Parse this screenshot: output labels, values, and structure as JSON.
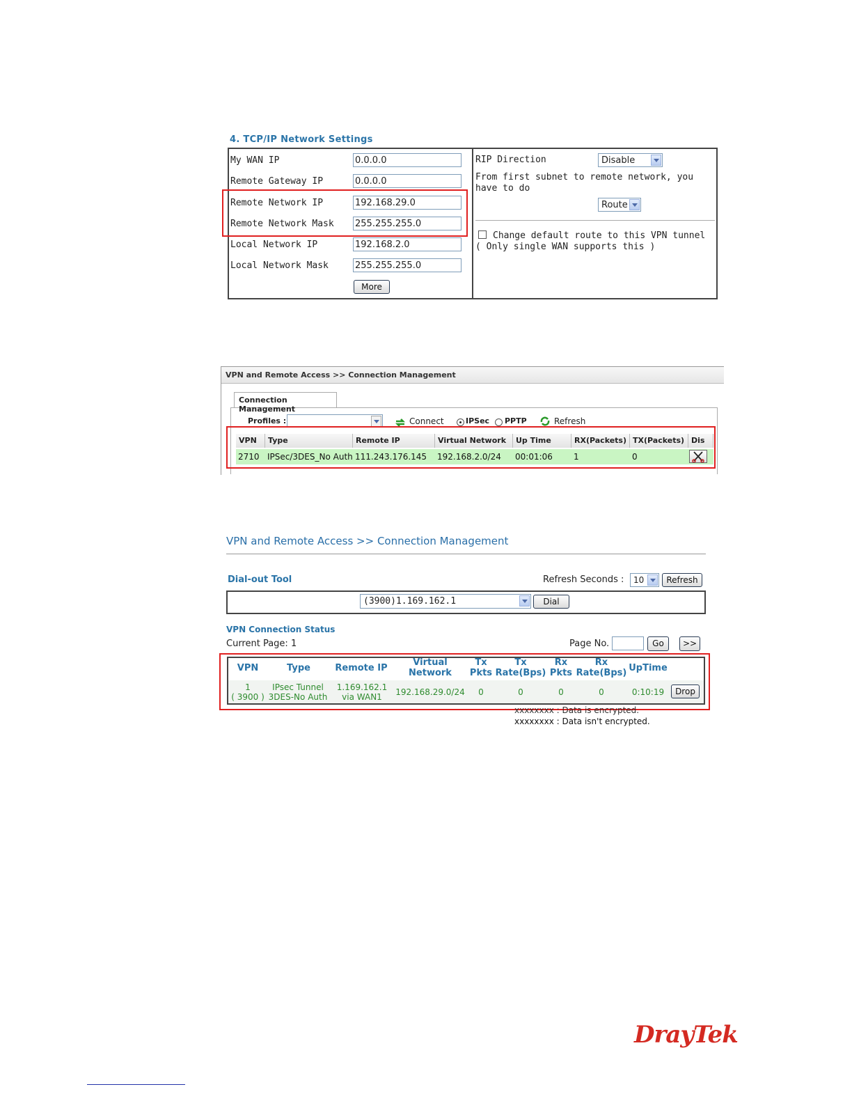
{
  "tcpip": {
    "title": "4. TCP/IP Network Settings",
    "left_fields": [
      {
        "label": "My WAN IP",
        "value": "0.0.0.0"
      },
      {
        "label": "Remote Gateway IP",
        "value": "0.0.0.0"
      },
      {
        "label": "Remote Network IP",
        "value": "192.168.29.0"
      },
      {
        "label": "Remote Network Mask",
        "value": "255.255.255.0"
      },
      {
        "label": "Local Network IP",
        "value": "192.168.2.0"
      },
      {
        "label": "Local Network Mask",
        "value": "255.255.255.0"
      }
    ],
    "more_label": "More",
    "rip_label": "RIP Direction",
    "rip_value": "Disable",
    "subnet_text": "From first subnet to remote network, you have to do",
    "subnet_value": "Route",
    "default_route_text": "Change default route to this VPN tunnel ( Only single WAN supports this )"
  },
  "conn_mgmt_1": {
    "header": "VPN and Remote Access >> Connection Management",
    "tab": "Connection Management",
    "profiles_label": "Profiles :",
    "connect_label": "Connect",
    "ipsec_label": "IPSec",
    "pptp_label": "PPTP",
    "refresh_label": "Refresh",
    "columns": [
      "VPN",
      "Type",
      "Remote IP",
      "Virtual Network",
      "Up Time",
      "RX(Packets)",
      "TX(Packets)",
      "Dis"
    ],
    "row": [
      "2710",
      "IPSec/3DES_No Auth",
      "111.243.176.145",
      "192.168.2.0/24",
      "00:01:06",
      "1",
      "0"
    ]
  },
  "conn_mgmt_2": {
    "header": "VPN and Remote Access >> Connection Management",
    "dialout_title": "Dial-out Tool",
    "refresh_seconds_label": "Refresh Seconds :",
    "refresh_seconds_value": "10",
    "refresh_button": "Refresh",
    "dial_profile": "(3900)1.169.162.1",
    "dial_button": "Dial",
    "status_title": "VPN Connection Status",
    "current_page": "Current Page: 1",
    "page_no_label": "Page No.",
    "go_button": "Go",
    "next_button": ">>",
    "columns": {
      "vpn": "VPN",
      "type": "Type",
      "remote_ip": "Remote IP",
      "virtual_1": "Virtual",
      "virtual_2": "Network",
      "tx_1": "Tx",
      "tx_2": "Pkts",
      "txr_1": "Tx",
      "txr_2": "Rate(Bps)",
      "rx_1": "Rx",
      "rx_2": "Pkts",
      "rxr_1": "Rx",
      "rxr_2": "Rate(Bps)",
      "uptime": "UpTime"
    },
    "row": {
      "vpn_1": "1",
      "vpn_2": "( 3900 )",
      "type_1": "IPsec Tunnel",
      "type_2": "3DES-No Auth",
      "ip_1": "1.169.162.1",
      "ip_2": "via WAN1",
      "network": "192.168.29.0/24",
      "tx_pkts": "0",
      "tx_rate": "0",
      "rx_pkts": "0",
      "rx_rate": "0",
      "uptime": "0:10:19",
      "drop": "Drop"
    },
    "legend_1": "xxxxxxxx : Data is encrypted.",
    "legend_2": "xxxxxxxx : Data isn't encrypted."
  },
  "brand": "DrayTek"
}
